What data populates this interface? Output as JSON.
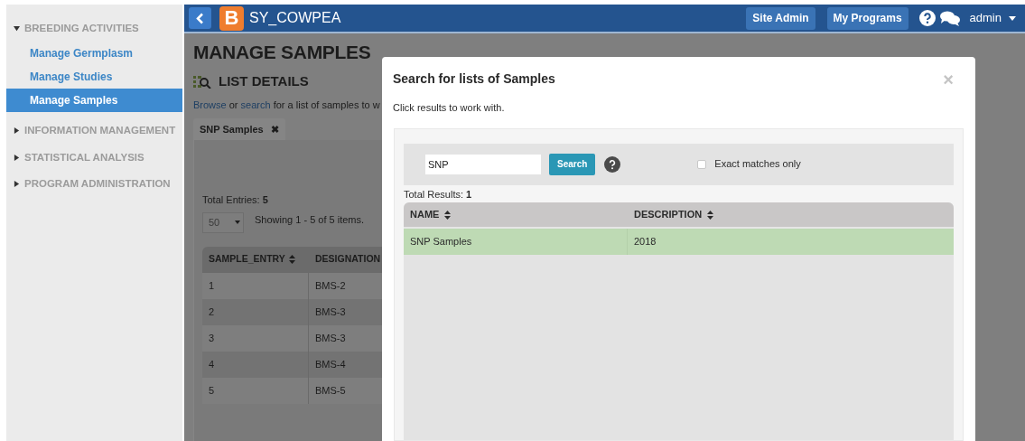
{
  "sidebar": {
    "sections": [
      {
        "label": "BREEDING ACTIVITIES",
        "expanded": true,
        "items": [
          {
            "label": "Manage Germplasm",
            "selected": false
          },
          {
            "label": "Manage Studies",
            "selected": false
          },
          {
            "label": "Manage Samples",
            "selected": true
          }
        ]
      },
      {
        "label": "INFORMATION MANAGEMENT",
        "expanded": false
      },
      {
        "label": "STATISTICAL ANALYSIS",
        "expanded": false
      },
      {
        "label": "PROGRAM ADMINISTRATION",
        "expanded": false
      }
    ]
  },
  "topbar": {
    "logo_letter": "B",
    "program": "SY_COWPEA",
    "buttons": [
      "Site Admin",
      "My Programs"
    ],
    "user": "admin"
  },
  "page": {
    "title": "MANAGE SAMPLES",
    "section_title": "LIST DETAILS",
    "intro": [
      {
        "kind": "link",
        "text": "Browse"
      },
      {
        "kind": "text",
        "text": " or "
      },
      {
        "kind": "link",
        "text": "search"
      },
      {
        "kind": "text",
        "text": " for a list of samples to w"
      }
    ],
    "tab": {
      "label": "SNP Samples",
      "close": "✖"
    },
    "total_entries": {
      "label": "Total Entries:",
      "value": "5"
    },
    "page_size": "50",
    "showing": "Showing 1 - 5 of 5 items.",
    "table": {
      "columns": [
        "SAMPLE_ENTRY",
        "DESIGNATION"
      ],
      "rows": [
        [
          "1",
          "BMS-2"
        ],
        [
          "2",
          "BMS-3"
        ],
        [
          "3",
          "BMS-3"
        ],
        [
          "4",
          "BMS-4"
        ],
        [
          "5",
          "BMS-5"
        ]
      ]
    }
  },
  "modal": {
    "title": "Search for lists of Samples",
    "close": "×",
    "hint": "Click results to work with.",
    "search": {
      "value": "SNP",
      "button": "Search",
      "exact_label": "Exact matches only",
      "exact_checked": false
    },
    "total_results": {
      "label": "Total Results:",
      "value": "1"
    },
    "table": {
      "columns": [
        "NAME",
        "DESCRIPTION"
      ],
      "rows": [
        {
          "cells": [
            "SNP Samples",
            "2018"
          ],
          "selected": true
        }
      ]
    }
  }
}
